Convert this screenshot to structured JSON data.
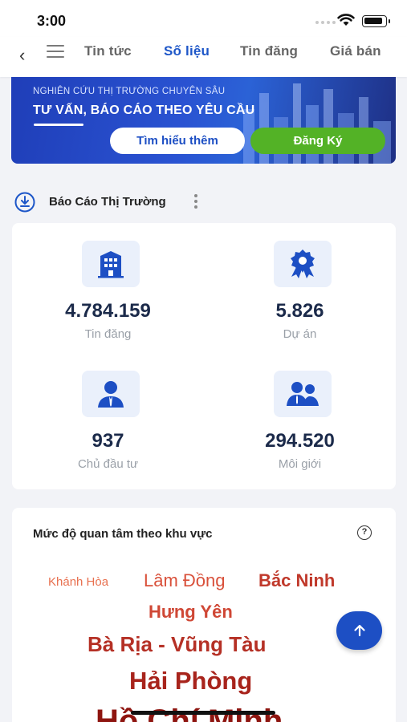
{
  "status_bar": {
    "time": "3:00"
  },
  "nav": {
    "tabs": [
      {
        "label": "Tin tức",
        "active": false
      },
      {
        "label": "Số liệu",
        "active": true
      },
      {
        "label": "Tin đăng",
        "active": false
      },
      {
        "label": "Giá bán",
        "active": false
      }
    ]
  },
  "banner": {
    "kicker": "NGHIÊN CỨU THỊ TRƯỜNG CHUYÊN SÂU",
    "title": "TƯ VẤN, BÁO CÁO THEO YÊU CẦU",
    "learn_more": "Tìm hiểu thêm",
    "register": "Đăng Ký"
  },
  "report_section": {
    "title": "Báo Cáo Thị Trường"
  },
  "stats": [
    {
      "icon": "building-icon",
      "value": "4.784.159",
      "label": "Tin đăng"
    },
    {
      "icon": "award-badge-icon",
      "value": "5.826",
      "label": "Dự án"
    },
    {
      "icon": "investor-person-icon",
      "value": "937",
      "label": "Chủ đầu tư"
    },
    {
      "icon": "brokers-group-icon",
      "value": "294.520",
      "label": "Môi giới"
    }
  ],
  "interest": {
    "title": "Mức độ quan tâm theo khu vực",
    "words": [
      {
        "text": "Khánh Hòa",
        "color": "#e8704f"
      },
      {
        "text": "Lâm Đồng",
        "color": "#d9503a"
      },
      {
        "text": "Bắc Ninh",
        "color": "#c0392b"
      },
      {
        "text": "Hưng Yên",
        "color": "#cf4735"
      },
      {
        "text": "Bà Rịa - Vũng Tàu",
        "color": "#b53025"
      },
      {
        "text": "Hải Phòng",
        "color": "#a8241c"
      },
      {
        "text": "Hồ Chí Minh",
        "color": "#8e1510"
      }
    ]
  },
  "colors": {
    "accent": "#1d56c8",
    "green": "#53b226",
    "fab": "#1d4fc4"
  }
}
